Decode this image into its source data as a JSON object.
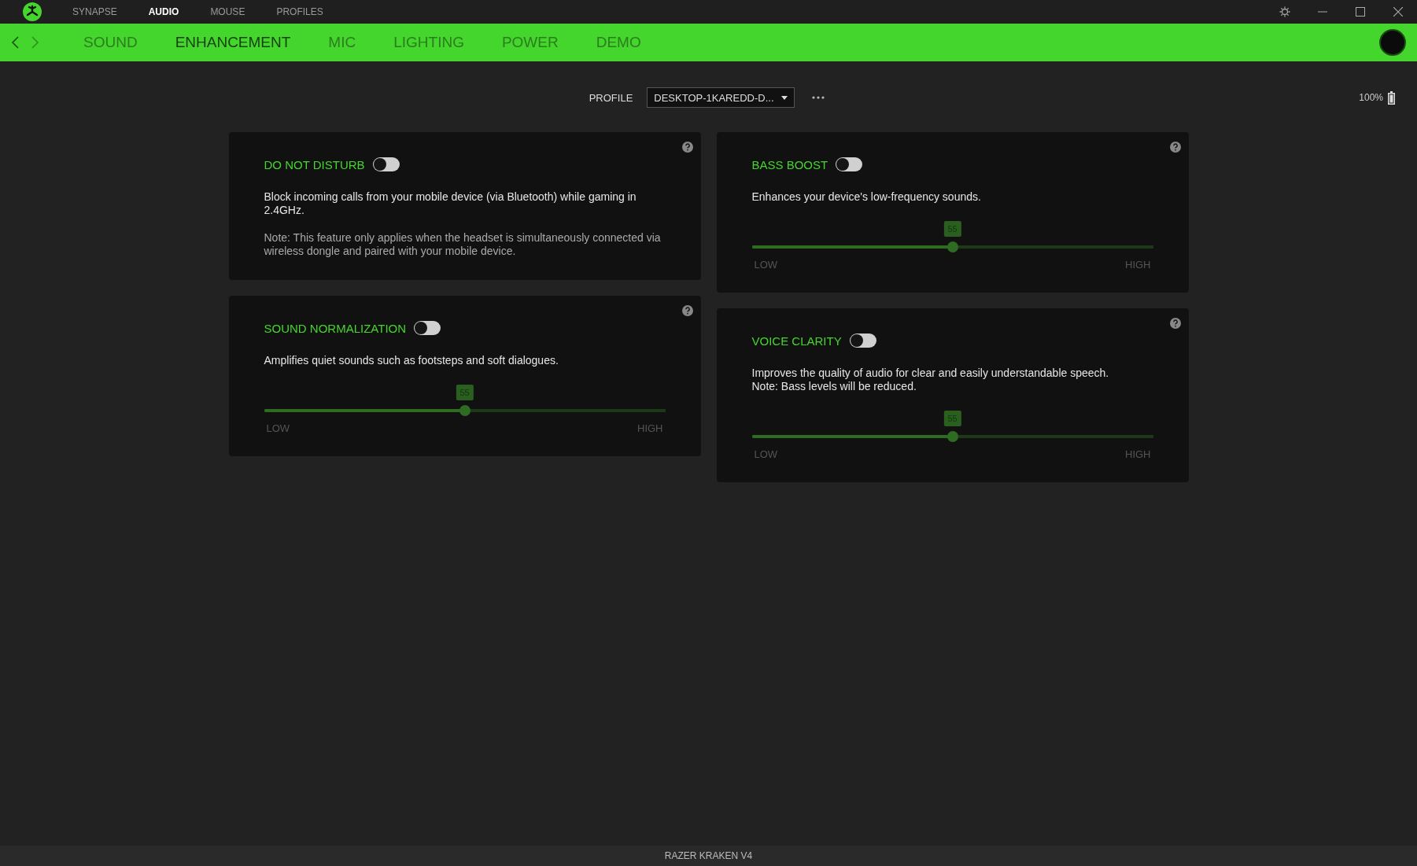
{
  "top_nav": [
    {
      "label": "SYNAPSE",
      "selected": false
    },
    {
      "label": "AUDIO",
      "selected": true
    },
    {
      "label": "MOUSE",
      "selected": false
    },
    {
      "label": "PROFILES",
      "selected": false
    }
  ],
  "sub_nav": [
    {
      "label": "SOUND",
      "selected": false
    },
    {
      "label": "ENHANCEMENT",
      "selected": true
    },
    {
      "label": "MIC",
      "selected": false
    },
    {
      "label": "LIGHTING",
      "selected": false
    },
    {
      "label": "POWER",
      "selected": false
    },
    {
      "label": "DEMO",
      "selected": false
    }
  ],
  "profile": {
    "label": "PROFILE",
    "value": "DESKTOP-1KAREDD-D..."
  },
  "battery": "100%",
  "columns": [
    [
      {
        "title": "DO NOT DISTURB",
        "on": false,
        "description": "Block incoming calls from your mobile device (via Bluetooth) while gaming in 2.4GHz.",
        "note": "Note: This feature only applies when the headset is simultaneously connected via wireless dongle and paired with your mobile device."
      },
      {
        "title": "SOUND NORMALIZATION",
        "on": false,
        "description": "Amplifies quiet sounds such as footsteps and soft dialogues.",
        "slider": {
          "value": "55",
          "level": 0.5,
          "low": "LOW",
          "high": "HIGH"
        }
      }
    ],
    [
      {
        "title": "BASS BOOST",
        "on": false,
        "description": "Enhances your device's low-frequency sounds.",
        "slider": {
          "value": "55",
          "level": 0.5,
          "low": "LOW",
          "high": "HIGH"
        }
      },
      {
        "title": "VOICE CLARITY",
        "on": false,
        "description": "Improves the quality of audio for clear and easily understandable speech.\nNote: Bass levels will be reduced.",
        "slider": {
          "value": "55",
          "level": 0.5,
          "low": "LOW",
          "high": "HIGH"
        }
      }
    ]
  ],
  "device": "RAZER KRAKEN V4"
}
